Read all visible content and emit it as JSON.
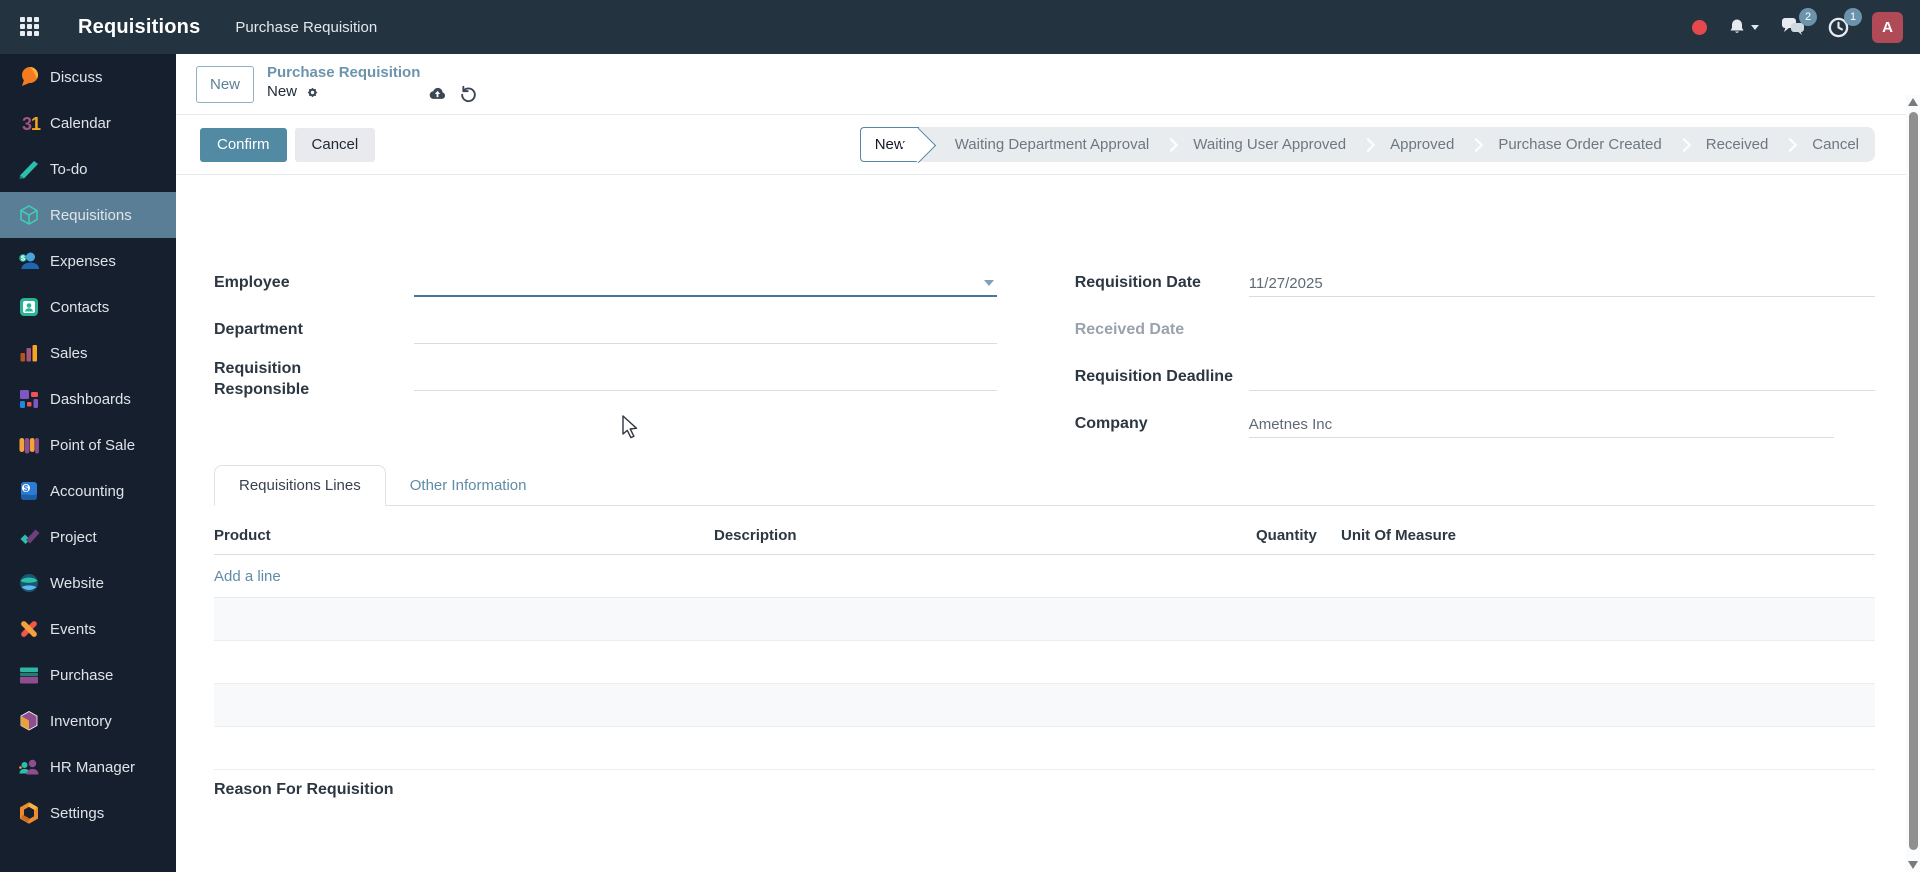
{
  "topbar": {
    "app_title": "Requisitions",
    "menu_item": "Purchase Requisition",
    "message_badge": "2",
    "activity_badge": "1",
    "avatar_letter": "A"
  },
  "sidebar": {
    "items": [
      {
        "label": "Discuss"
      },
      {
        "label": "Calendar"
      },
      {
        "label": "To-do"
      },
      {
        "label": "Requisitions",
        "active": true
      },
      {
        "label": "Expenses"
      },
      {
        "label": "Contacts"
      },
      {
        "label": "Sales"
      },
      {
        "label": "Dashboards"
      },
      {
        "label": "Point of Sale"
      },
      {
        "label": "Accounting"
      },
      {
        "label": "Project"
      },
      {
        "label": "Website"
      },
      {
        "label": "Events"
      },
      {
        "label": "Purchase"
      },
      {
        "label": "Inventory"
      },
      {
        "label": "HR Manager"
      },
      {
        "label": "Settings"
      }
    ]
  },
  "breadcrumb": {
    "new_button": "New",
    "parent": "Purchase Requisition",
    "current": "New"
  },
  "statusbar": {
    "confirm": "Confirm",
    "cancel": "Cancel",
    "stages": [
      {
        "label": "New",
        "active": true
      },
      {
        "label": "Waiting Department Approval"
      },
      {
        "label": "Waiting User Approved"
      },
      {
        "label": "Approved"
      },
      {
        "label": "Purchase Order Created"
      },
      {
        "label": "Received"
      },
      {
        "label": "Cancel"
      }
    ]
  },
  "form": {
    "employee": {
      "label": "Employee",
      "value": ""
    },
    "department": {
      "label": "Department",
      "value": ""
    },
    "requisition_responsible": {
      "label": "Requisition Responsible",
      "value": ""
    },
    "requisition_date": {
      "label": "Requisition Date",
      "value": "11/27/2025"
    },
    "received_date": {
      "label": "Received Date",
      "value": ""
    },
    "requisition_deadline": {
      "label": "Requisition Deadline",
      "value": ""
    },
    "company": {
      "label": "Company",
      "value": "Ametnes Inc"
    }
  },
  "tabs": {
    "lines": "Requisitions Lines",
    "other": "Other Information"
  },
  "lines_table": {
    "columns": [
      "Product",
      "Description",
      "Quantity",
      "Unit Of Measure"
    ],
    "add_line": "Add a line"
  },
  "reason_label": "Reason For Requisition",
  "colors": {
    "topbar_bg": "#243340",
    "sidebar_bg": "#161f2e",
    "sidebar_active_bg": "#5b7e97",
    "primary_button": "#5289a3",
    "link": "#5f8ca6",
    "avatar_bg": "#b04a56",
    "badge_bg": "#6b93ac",
    "record_dot": "#e5484d"
  }
}
